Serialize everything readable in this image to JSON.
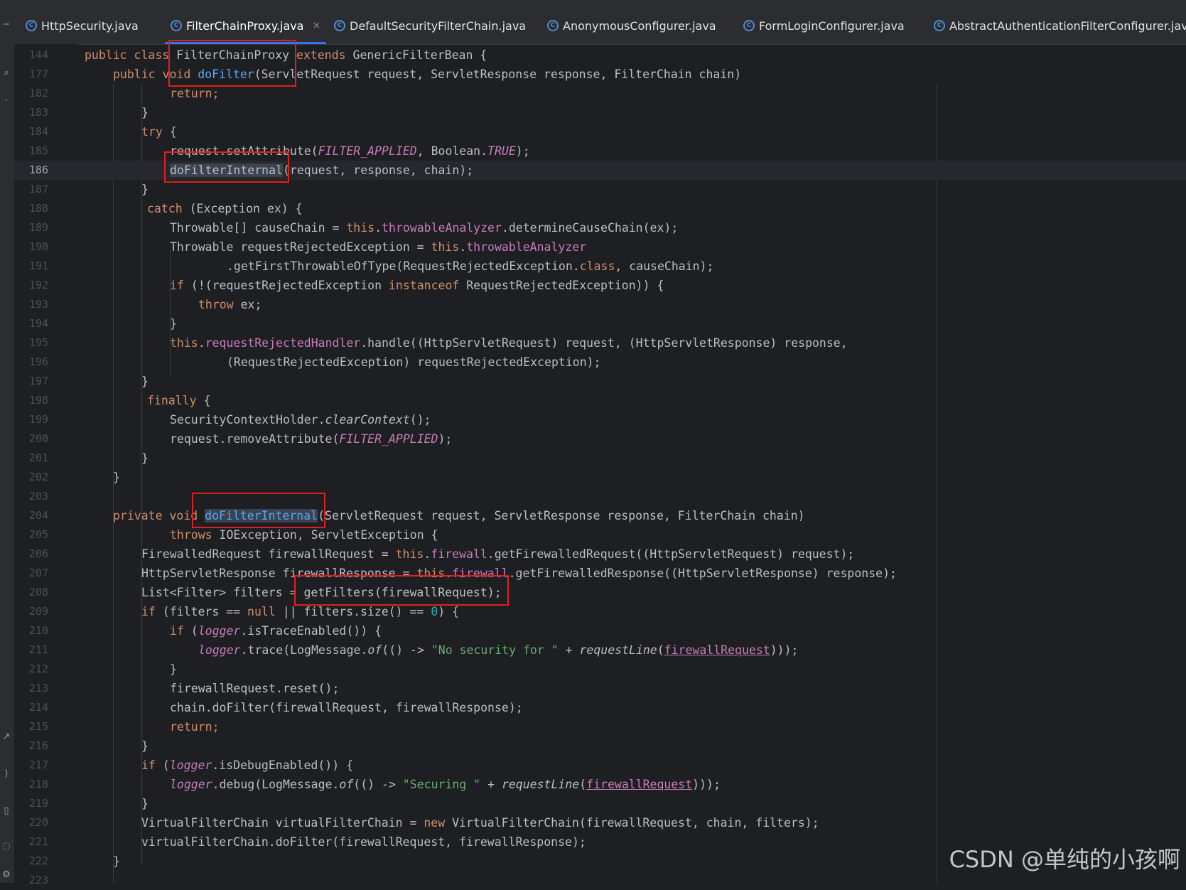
{
  "tabs": [
    {
      "label": "HttpSecurity.java",
      "active": false
    },
    {
      "label": "FilterChainProxy.java",
      "active": true,
      "close": "×"
    },
    {
      "label": "DefaultSecurityFilterChain.java",
      "active": false
    },
    {
      "label": "AnonymousConfigurer.java",
      "active": false
    },
    {
      "label": "FormLoginConfigurer.java",
      "active": false
    },
    {
      "label": "AbstractAuthenticationFilterConfigurer.java",
      "active": false
    }
  ],
  "tab_icon": "java-class-icon",
  "line_numbers": [
    "144",
    "177",
    "182",
    "183",
    "184",
    "185",
    "186",
    "187",
    "188",
    "189",
    "190",
    "191",
    "192",
    "193",
    "194",
    "195",
    "196",
    "197",
    "198",
    "199",
    "200",
    "201",
    "202",
    "203",
    "204",
    "205",
    "206",
    "207",
    "208",
    "209",
    "210",
    "211",
    "212",
    "213",
    "214",
    "215",
    "216",
    "217",
    "218",
    "219",
    "220",
    "221",
    "222",
    "223"
  ],
  "current_line": "186",
  "code": {
    "public": "public",
    "class": "class",
    "private": "private",
    "void": "void",
    "extends": "extends",
    "try": "try",
    "catch": "catch",
    "finally": "finally",
    "if": "if",
    "throw": "throw",
    "throws": "throws",
    "return": "return",
    "this": "this",
    "new": "new",
    "null": "null",
    "instanceof": "instanceof",
    "class_kw": "class",
    "zero": "0",
    "class_decl": " FilterChainProxy ",
    "class_tail": " GenericFilterBean {",
    "dofilter_name": "doFilter",
    "dofilter_params": "(ServletRequest request, ServletResponse response, FilterChain chain)",
    "l182": "return;",
    "close_brace": "}",
    "brace_open": " {",
    "l185_a": "request.setAttribute(",
    "filter_applied": "FILTER_APPLIED",
    "l185_b": ", Boolean.",
    "true_const": "TRUE",
    "l185_c": ");",
    "l186_name": "doFilterInternal",
    "l186_rest": "(request, response, chain);",
    "l188_rest": " (Exception ex) {",
    "l189_a": "Throwable[] causeChain = ",
    "throwable_analyzer": "throwableAnalyzer",
    "l189_b": ".determineCauseChain(ex);",
    "l190_a": "Throwable requestRejectedException = ",
    "l191": ".getFirstThrowableOfType(RequestRejectedException.",
    "l191_b": ", causeChain);",
    "l192_a": " (!(requestRejectedException ",
    "l192_b": " RequestRejectedException)) {",
    "l193": " ex;",
    "request_rejected_handler": "requestRejectedHandler",
    "l195_b": ".handle((HttpServletRequest) request, (HttpServletResponse) response,",
    "l196": "(RequestRejectedException) requestRejectedException);",
    "l199_a": "SecurityContextHolder.",
    "clear_context": "clearContext",
    "l199_b": "();",
    "l200_a": "request.removeAttribute(",
    "l200_b": ");",
    "l204_rest": "(ServletRequest request, ServletResponse response, FilterChain chain)",
    "l205": " IOException, ServletException {",
    "l206_a": "FirewalledRequest firewallRequest = ",
    "firewall": "firewall",
    "l206_b": ".getFirewalledRequest((HttpServletRequest) request);",
    "l207_a": "HttpServletResponse firewallResponse = ",
    "l207_b": ".getFirewalledResponse((HttpServletResponse) response);",
    "l208_a": "List<Filter> filters = ",
    "l208_b": "getFilters(firewallRequest);",
    "l209_a": " (filters == ",
    "l209_b": " || filters.size() == ",
    "l209_c": ") {",
    "logger": "logger",
    "l210_b": ".isTraceEnabled()) {",
    "paren_open": " (",
    "l211_a": ".trace(LogMessage.",
    "of": "of",
    "l211_b": "(() -> ",
    "no_security": "\"No security for \"",
    "plus": " + ",
    "request_line": "requestLine",
    "paren": "(",
    "firewall_request": "firewallRequest",
    "l211_c": "));",
    "l211_d": ")));",
    "l213": "firewallRequest.reset();",
    "l214": "chain.doFilter(firewallRequest, firewallResponse);",
    "l217_b": ".isDebugEnabled()) {",
    "l218_a": ".debug(LogMessage.",
    "securing": "\"Securing \"",
    "l220_a": "VirtualFilterChain virtualFilterChain = ",
    "l220_b": " VirtualFilterChain(firewallRequest, chain, filters);",
    "l221": "virtualFilterChain.doFilter(firewallRequest, firewallResponse);"
  },
  "watermark": "CSDN @单纯的小孩啊",
  "colors": {
    "background": "#1e1f22",
    "keyword": "#cf8e6d",
    "function": "#56a8f5",
    "field": "#c77dbb",
    "string": "#6aab73",
    "number": "#2aacb8",
    "annotation_box": "#e02020"
  }
}
